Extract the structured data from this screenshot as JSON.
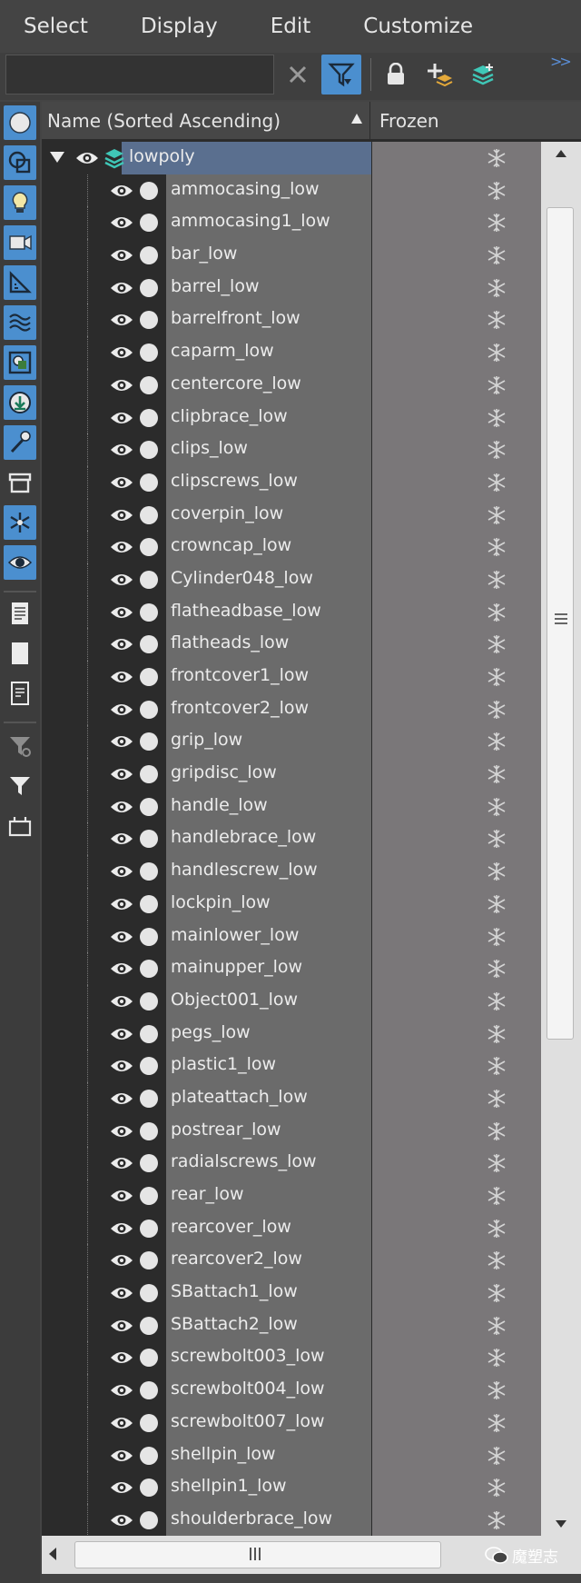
{
  "menu": [
    "Select",
    "Display",
    "Edit",
    "Customize"
  ],
  "toolbar": {
    "search_value": "",
    "search_placeholder": ""
  },
  "columns": {
    "name": "Name (Sorted Ascending)",
    "frozen": "Frozen"
  },
  "parent": {
    "label": "lowpoly"
  },
  "items": [
    "ammocasing_low",
    "ammocasing1_low",
    "bar_low",
    "barrel_low",
    "barrelfront_low",
    "caparm_low",
    "centercore_low",
    "clipbrace_low",
    "clips_low",
    "clipscrews_low",
    "coverpin_low",
    "crowncap_low",
    "Cylinder048_low",
    "flatheadbase_low",
    "flatheads_low",
    "frontcover1_low",
    "frontcover2_low",
    "grip_low",
    "gripdisc_low",
    "handle_low",
    "handlebrace_low",
    "handlescrew_low",
    "lockpin_low",
    "mainlower_low",
    "mainupper_low",
    "Object001_low",
    "pegs_low",
    "plastic1_low",
    "plateattach_low",
    "postrear_low",
    "radialscrews_low",
    "rear_low",
    "rearcover_low",
    "rearcover2_low",
    "SBattach1_low",
    "SBattach2_low",
    "screwbolt003_low",
    "screwbolt004_low",
    "screwbolt007_low",
    "shellpin_low",
    "shellpin1_low",
    "shoulderbrace_low"
  ],
  "watermark": "魔塑志",
  "icons": {
    "sidebar": [
      "sphere-icon",
      "shapes-icon",
      "light-icon",
      "camera-icon",
      "helper-icon",
      "spacewarp-icon",
      "group-icon",
      "xref-icon",
      "bone-icon",
      "container-icon",
      "frozen-filter-icon",
      "hidden-filter-icon",
      "list-icon",
      "blank-icon",
      "list-detail-icon",
      "filter-settings-icon",
      "funnel-icon",
      "container-toggle-icon"
    ]
  },
  "colors": {
    "accent": "#4b8fcf",
    "selected_row": "#5a6f8f",
    "row_bg": "#6b6b6b",
    "frozen_bg": "#7a7779"
  }
}
